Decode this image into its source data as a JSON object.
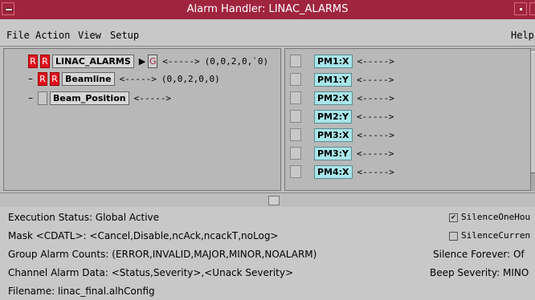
{
  "window": {
    "title": "Alarm Handler: LINAC_ALARMS"
  },
  "menu": {
    "file": "File",
    "action": "Action",
    "view": "View",
    "setup": "Setup",
    "help": "Help"
  },
  "tree": [
    {
      "name": "LINAC_ALARMS",
      "r1": "R",
      "r2": "R",
      "g": "G",
      "arrow": "<----->",
      "counts": "(0,0,2,0,`0)"
    },
    {
      "name": "Beamline",
      "r1": "R",
      "r2": "R",
      "arrow": "<----->",
      "counts": "(0,0,2,0,0)"
    },
    {
      "name": "Beam_Position",
      "arrow": "<----->"
    }
  ],
  "channels": [
    {
      "name": "PM1:X",
      "arrow": "<----->"
    },
    {
      "name": "PM1:Y",
      "arrow": "<----->"
    },
    {
      "name": "PM2:X",
      "arrow": "<----->"
    },
    {
      "name": "PM2:Y",
      "arrow": "<----->"
    },
    {
      "name": "PM3:X",
      "arrow": "<----->"
    },
    {
      "name": "PM3:Y",
      "arrow": "<----->"
    },
    {
      "name": "PM4:X",
      "arrow": "<----->"
    }
  ],
  "status": {
    "execution": "Execution Status: Global Active",
    "mask": "Mask <CDATL>: <Cancel,Disable,ncAck,ncackT,noLog>",
    "group_counts": "Group Alarm Counts: (ERROR,INVALID,MAJOR,MINOR,NOALARM)",
    "channel_data": "Channel Alarm Data: <Status,Severity>,<Unack Severity>",
    "filename": "Filename:  linac_final.alhConfig",
    "silence_one_hour": "SilenceOneHou",
    "silence_one_hour_checked": true,
    "silence_current": "SilenceCurren",
    "silence_current_checked": false,
    "silence_forever": "Silence Forever:  Of",
    "beep_severity": "Beep Severity:  MINO"
  },
  "colors": {
    "titlebar": "#a0243d",
    "alarm_red": "#e0101c",
    "channel_cyan": "#a8e6ea"
  }
}
